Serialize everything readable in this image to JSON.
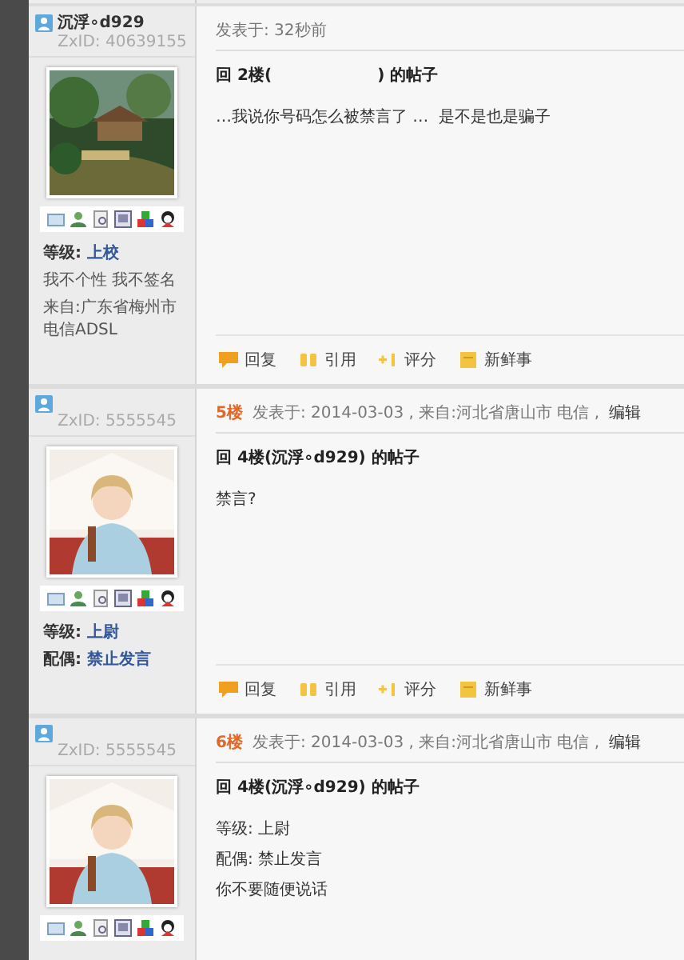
{
  "posts": [
    {
      "author": {
        "name": "沉浮∘d929",
        "zxid": "ZxID: 40639155",
        "info": [
          {
            "kind": "field",
            "label": "等级:",
            "value": "上校"
          },
          {
            "kind": "text",
            "text": "我不个性 我不签名"
          },
          {
            "kind": "text",
            "text": "来自:广东省梅州市电信ADSL"
          }
        ]
      },
      "header": {
        "meta": "发表于: 32秒前"
      },
      "title": "回 2楼(                   ) 的帖子",
      "body": [
        "…我说你号码怎么被禁言了 …  是不是也是骗子"
      ],
      "actions": [
        {
          "kind": "reply",
          "label": "回复"
        },
        {
          "kind": "quote",
          "label": "引用"
        },
        {
          "kind": "rate",
          "label": "评分"
        },
        {
          "kind": "news",
          "label": "新鲜事"
        }
      ]
    },
    {
      "author": {
        "zxid": "ZxID: 5555545",
        "info": [
          {
            "kind": "field",
            "label": "等级:",
            "value": "上尉"
          },
          {
            "kind": "field",
            "label": "配偶:",
            "value": "禁止发言"
          }
        ]
      },
      "header": {
        "floor": "5楼",
        "meta": "发表于: 2014-03-03 , 来自:河北省唐山市 电信 ,",
        "edit": "编辑"
      },
      "title": "回 4楼(沉浮∘d929) 的帖子",
      "body": [
        "禁言?"
      ],
      "actions": [
        {
          "kind": "reply",
          "label": "回复"
        },
        {
          "kind": "quote",
          "label": "引用"
        },
        {
          "kind": "rate",
          "label": "评分"
        },
        {
          "kind": "news",
          "label": "新鲜事"
        }
      ]
    },
    {
      "author": {
        "zxid": "ZxID: 5555545"
      },
      "header": {
        "floor": "6楼",
        "meta": "发表于: 2014-03-03 , 来自:河北省唐山市 电信 ,",
        "edit": "编辑"
      },
      "title": "回 4楼(沉浮∘d929) 的帖子",
      "body": [
        "等级: 上尉",
        "配偶: 禁止发言",
        "你不要随便说话"
      ]
    }
  ]
}
